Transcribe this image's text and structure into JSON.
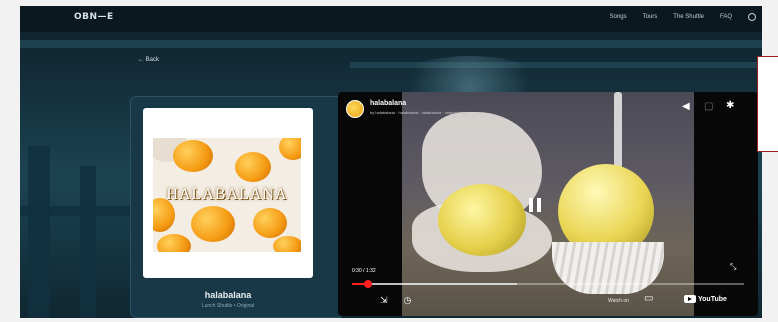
{
  "header": {
    "logo": "OBN—E",
    "nav": [
      "Songs",
      "Tours",
      "The Shuttle",
      "FAQ"
    ]
  },
  "back_label": "← Back",
  "album": {
    "art_text": "HALABALANA",
    "title": "halabalana",
    "subtitle": "Lunch Shuttle • Original"
  },
  "player": {
    "channel_title": "halabalana",
    "channel_subtitle": "by halabalana · halabalana · halabalana · original single",
    "time": "0:30 / 1:32",
    "progress_fraction": 0.04,
    "buffered_fraction": 0.42,
    "watch_on_label": "Watch on",
    "youtube_label": "YouTube"
  },
  "colors": {
    "accent_progress": "#ff1f1f",
    "page_bg": "#1d4352"
  }
}
